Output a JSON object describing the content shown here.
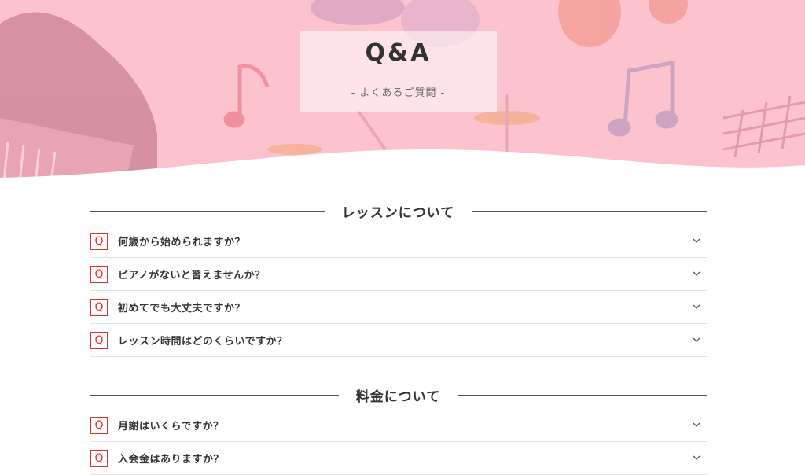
{
  "hero": {
    "title": "Q&A",
    "subtitle": "- よくあるご質問 -",
    "colors": {
      "background": "#fcc3cf",
      "accent": "#e0302a"
    }
  },
  "sections": [
    {
      "heading": "レッスンについて",
      "items": [
        {
          "question": "何歳から始められますか？"
        },
        {
          "question": "ピアノがないと習えませんか？"
        },
        {
          "question": "初めてでも大丈夫ですか？"
        },
        {
          "question": "レッスン時間はどのくらいですか？"
        }
      ]
    },
    {
      "heading": "料金について",
      "items": [
        {
          "question": "月謝はいくらですか？"
        },
        {
          "question": "入会金はありますか？"
        }
      ]
    }
  ],
  "icons": {
    "question_marker": "Q",
    "expand": "chevron-down-icon"
  }
}
